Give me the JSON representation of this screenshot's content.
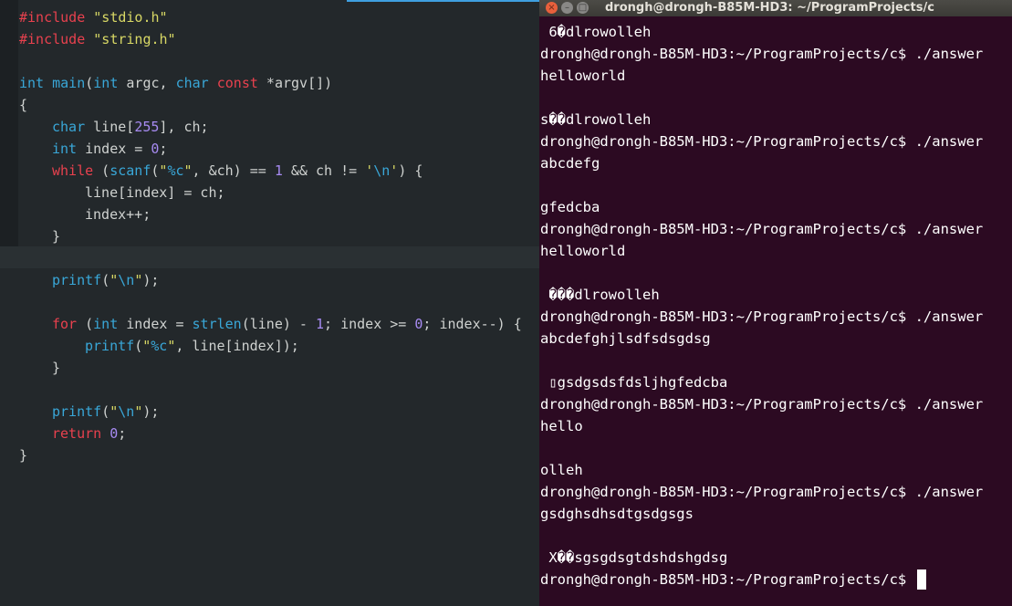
{
  "editor": {
    "lines": [
      {
        "indent": 0,
        "tokens": [
          {
            "c": "kw",
            "t": "#include"
          },
          {
            "c": "op",
            "t": " "
          },
          {
            "c": "st",
            "t": "\"stdio.h\""
          }
        ]
      },
      {
        "indent": 0,
        "tokens": [
          {
            "c": "kw",
            "t": "#include"
          },
          {
            "c": "op",
            "t": " "
          },
          {
            "c": "st",
            "t": "\"string.h\""
          }
        ]
      },
      {
        "indent": 0,
        "tokens": []
      },
      {
        "indent": 0,
        "tokens": [
          {
            "c": "ty",
            "t": "int"
          },
          {
            "c": "op",
            "t": " "
          },
          {
            "c": "fn",
            "t": "main"
          },
          {
            "c": "op",
            "t": "("
          },
          {
            "c": "ty",
            "t": "int"
          },
          {
            "c": "op",
            "t": " argc, "
          },
          {
            "c": "ty",
            "t": "char"
          },
          {
            "c": "op",
            "t": " "
          },
          {
            "c": "kw",
            "t": "const"
          },
          {
            "c": "op",
            "t": " *argv[])"
          }
        ]
      },
      {
        "indent": 0,
        "tokens": [
          {
            "c": "op",
            "t": "{"
          }
        ]
      },
      {
        "indent": 1,
        "tokens": [
          {
            "c": "ty",
            "t": "char"
          },
          {
            "c": "op",
            "t": " line["
          },
          {
            "c": "nu",
            "t": "255"
          },
          {
            "c": "op",
            "t": "], ch;"
          }
        ]
      },
      {
        "indent": 1,
        "tokens": [
          {
            "c": "ty",
            "t": "int"
          },
          {
            "c": "op",
            "t": " index = "
          },
          {
            "c": "nu",
            "t": "0"
          },
          {
            "c": "op",
            "t": ";"
          }
        ]
      },
      {
        "indent": 1,
        "tokens": [
          {
            "c": "kw",
            "t": "while"
          },
          {
            "c": "op",
            "t": " ("
          },
          {
            "c": "fn",
            "t": "scanf"
          },
          {
            "c": "op",
            "t": "("
          },
          {
            "c": "st",
            "t": "\""
          },
          {
            "c": "es",
            "t": "%c"
          },
          {
            "c": "st",
            "t": "\""
          },
          {
            "c": "op",
            "t": ", &ch) == "
          },
          {
            "c": "nu",
            "t": "1"
          },
          {
            "c": "op",
            "t": " && ch != "
          },
          {
            "c": "st",
            "t": "'"
          },
          {
            "c": "es",
            "t": "\\n"
          },
          {
            "c": "st",
            "t": "'"
          },
          {
            "c": "op",
            "t": ") {"
          }
        ]
      },
      {
        "indent": 2,
        "tokens": [
          {
            "c": "op",
            "t": "line[index] = ch;"
          }
        ]
      },
      {
        "indent": 2,
        "tokens": [
          {
            "c": "op",
            "t": "index++;"
          }
        ]
      },
      {
        "indent": 1,
        "tokens": [
          {
            "c": "op",
            "t": "}"
          }
        ]
      },
      {
        "indent": 0,
        "tokens": []
      },
      {
        "indent": 1,
        "tokens": [
          {
            "c": "fn",
            "t": "printf"
          },
          {
            "c": "op",
            "t": "("
          },
          {
            "c": "st",
            "t": "\""
          },
          {
            "c": "es",
            "t": "\\n"
          },
          {
            "c": "st",
            "t": "\""
          },
          {
            "c": "op",
            "t": ");"
          }
        ]
      },
      {
        "indent": 0,
        "tokens": []
      },
      {
        "indent": 1,
        "tokens": [
          {
            "c": "kw",
            "t": "for"
          },
          {
            "c": "op",
            "t": " ("
          },
          {
            "c": "ty",
            "t": "int"
          },
          {
            "c": "op",
            "t": " index = "
          },
          {
            "c": "fn",
            "t": "strlen"
          },
          {
            "c": "op",
            "t": "(line) - "
          },
          {
            "c": "nu",
            "t": "1"
          },
          {
            "c": "op",
            "t": "; index >= "
          },
          {
            "c": "nu",
            "t": "0"
          },
          {
            "c": "op",
            "t": "; index--) {"
          }
        ]
      },
      {
        "indent": 2,
        "tokens": [
          {
            "c": "fn",
            "t": "printf"
          },
          {
            "c": "op",
            "t": "("
          },
          {
            "c": "st",
            "t": "\""
          },
          {
            "c": "es",
            "t": "%c"
          },
          {
            "c": "st",
            "t": "\""
          },
          {
            "c": "op",
            "t": ", line[index]);"
          }
        ]
      },
      {
        "indent": 1,
        "tokens": [
          {
            "c": "op",
            "t": "}"
          }
        ]
      },
      {
        "indent": 0,
        "tokens": []
      },
      {
        "indent": 1,
        "tokens": [
          {
            "c": "fn",
            "t": "printf"
          },
          {
            "c": "op",
            "t": "("
          },
          {
            "c": "st",
            "t": "\""
          },
          {
            "c": "es",
            "t": "\\n"
          },
          {
            "c": "st",
            "t": "\""
          },
          {
            "c": "op",
            "t": ");"
          }
        ]
      },
      {
        "indent": 1,
        "tokens": [
          {
            "c": "kw",
            "t": "return"
          },
          {
            "c": "op",
            "t": " "
          },
          {
            "c": "nu",
            "t": "0"
          },
          {
            "c": "op",
            "t": ";"
          }
        ]
      },
      {
        "indent": 0,
        "tokens": [
          {
            "c": "op",
            "t": "}"
          }
        ]
      }
    ]
  },
  "terminal": {
    "title": "drongh@drongh-B85M-HD3: ~/ProgramProjects/c",
    "window_buttons": {
      "close": "×",
      "minimize": "–",
      "maximize": "□"
    },
    "prompt": "drongh@drongh-B85M-HD3:~/ProgramProjects/c$ ",
    "lines": [
      " 6�dlrowolleh",
      "drongh@drongh-B85M-HD3:~/ProgramProjects/c$ ./answer",
      "helloworld",
      "",
      "s��dlrowolleh",
      "drongh@drongh-B85M-HD3:~/ProgramProjects/c$ ./answer",
      "abcdefg",
      "",
      "gfedcba",
      "drongh@drongh-B85M-HD3:~/ProgramProjects/c$ ./answer",
      "helloworld",
      "",
      " ���dlrowolleh",
      "drongh@drongh-B85M-HD3:~/ProgramProjects/c$ ./answer",
      "abcdefghjlsdfsdsgdsg",
      "",
      " ▯gsdgsdsfdsljhgfedcba",
      "drongh@drongh-B85M-HD3:~/ProgramProjects/c$ ./answer",
      "hello",
      "",
      "olleh",
      "drongh@drongh-B85M-HD3:~/ProgramProjects/c$ ./answer",
      "gsdghsdhsdtgsdgsgs",
      "",
      " X��sgsgdsgtdshdshgdsg"
    ]
  }
}
